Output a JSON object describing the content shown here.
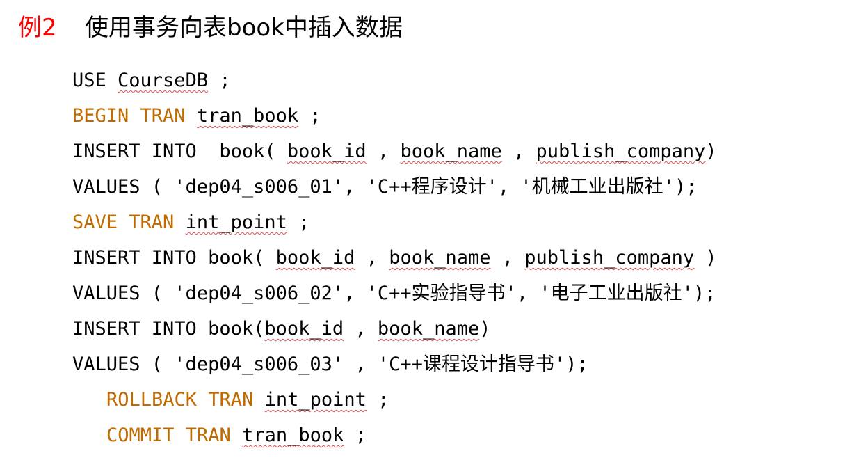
{
  "heading": {
    "number": "例2",
    "title": "使用事务向表book中插入数据"
  },
  "colors": {
    "heading_number": "#ff0000",
    "keyword": "#c06a00",
    "text": "#000000",
    "spellcheck_underline": "#e05050"
  },
  "code_lines": [
    {
      "indent": false,
      "segments": [
        {
          "text": "USE ",
          "kw": false,
          "squiggle": false
        },
        {
          "text": "CourseDB",
          "kw": false,
          "squiggle": true
        },
        {
          "text": " ;",
          "kw": false,
          "squiggle": false
        }
      ]
    },
    {
      "indent": false,
      "segments": [
        {
          "text": "BEGIN TRAN",
          "kw": true,
          "squiggle": false
        },
        {
          "text": " ",
          "kw": false,
          "squiggle": false
        },
        {
          "text": "tran_book",
          "kw": false,
          "squiggle": true
        },
        {
          "text": " ;",
          "kw": false,
          "squiggle": false
        }
      ]
    },
    {
      "indent": false,
      "segments": [
        {
          "text": "INSERT INTO  book( ",
          "kw": false,
          "squiggle": false
        },
        {
          "text": "book_id",
          "kw": false,
          "squiggle": true
        },
        {
          "text": " , ",
          "kw": false,
          "squiggle": false
        },
        {
          "text": "book_name",
          "kw": false,
          "squiggle": true
        },
        {
          "text": " , ",
          "kw": false,
          "squiggle": false
        },
        {
          "text": "publish_company",
          "kw": false,
          "squiggle": true
        },
        {
          "text": ")",
          "kw": false,
          "squiggle": false
        }
      ]
    },
    {
      "indent": false,
      "segments": [
        {
          "text": "VALUES ( 'dep04_s006_01', 'C++程序设计', '机械工业出版社');",
          "kw": false,
          "squiggle": false
        }
      ]
    },
    {
      "indent": false,
      "segments": [
        {
          "text": "SAVE TRAN",
          "kw": true,
          "squiggle": false
        },
        {
          "text": " ",
          "kw": false,
          "squiggle": false
        },
        {
          "text": "int_point",
          "kw": false,
          "squiggle": true
        },
        {
          "text": " ;",
          "kw": false,
          "squiggle": false
        }
      ]
    },
    {
      "indent": false,
      "segments": [
        {
          "text": "INSERT INTO book( ",
          "kw": false,
          "squiggle": false
        },
        {
          "text": "book_id",
          "kw": false,
          "squiggle": true
        },
        {
          "text": " , ",
          "kw": false,
          "squiggle": false
        },
        {
          "text": "book_name",
          "kw": false,
          "squiggle": true
        },
        {
          "text": " , ",
          "kw": false,
          "squiggle": false
        },
        {
          "text": "publish_company",
          "kw": false,
          "squiggle": true
        },
        {
          "text": " )",
          "kw": false,
          "squiggle": false
        }
      ]
    },
    {
      "indent": false,
      "segments": [
        {
          "text": "VALUES ( 'dep04_s006_02', 'C++实验指导书', '电子工业出版社');",
          "kw": false,
          "squiggle": false
        }
      ]
    },
    {
      "indent": false,
      "segments": [
        {
          "text": "INSERT INTO book(",
          "kw": false,
          "squiggle": false
        },
        {
          "text": "book_id",
          "kw": false,
          "squiggle": true
        },
        {
          "text": " , ",
          "kw": false,
          "squiggle": false
        },
        {
          "text": "book_name",
          "kw": false,
          "squiggle": true
        },
        {
          "text": ")",
          "kw": false,
          "squiggle": false
        }
      ]
    },
    {
      "indent": false,
      "segments": [
        {
          "text": "VALUES ( 'dep04_s006_03' , 'C++课程设计指导书');",
          "kw": false,
          "squiggle": false
        }
      ]
    },
    {
      "indent": true,
      "segments": [
        {
          "text": "ROLLBACK TRAN",
          "kw": true,
          "squiggle": false
        },
        {
          "text": " ",
          "kw": false,
          "squiggle": false
        },
        {
          "text": "int_point",
          "kw": false,
          "squiggle": true
        },
        {
          "text": " ;",
          "kw": false,
          "squiggle": false
        }
      ]
    },
    {
      "indent": true,
      "segments": [
        {
          "text": "COMMIT TRAN",
          "kw": true,
          "squiggle": false
        },
        {
          "text": " ",
          "kw": false,
          "squiggle": false
        },
        {
          "text": "tran_book",
          "kw": false,
          "squiggle": true
        },
        {
          "text": " ;",
          "kw": false,
          "squiggle": false
        }
      ]
    }
  ]
}
